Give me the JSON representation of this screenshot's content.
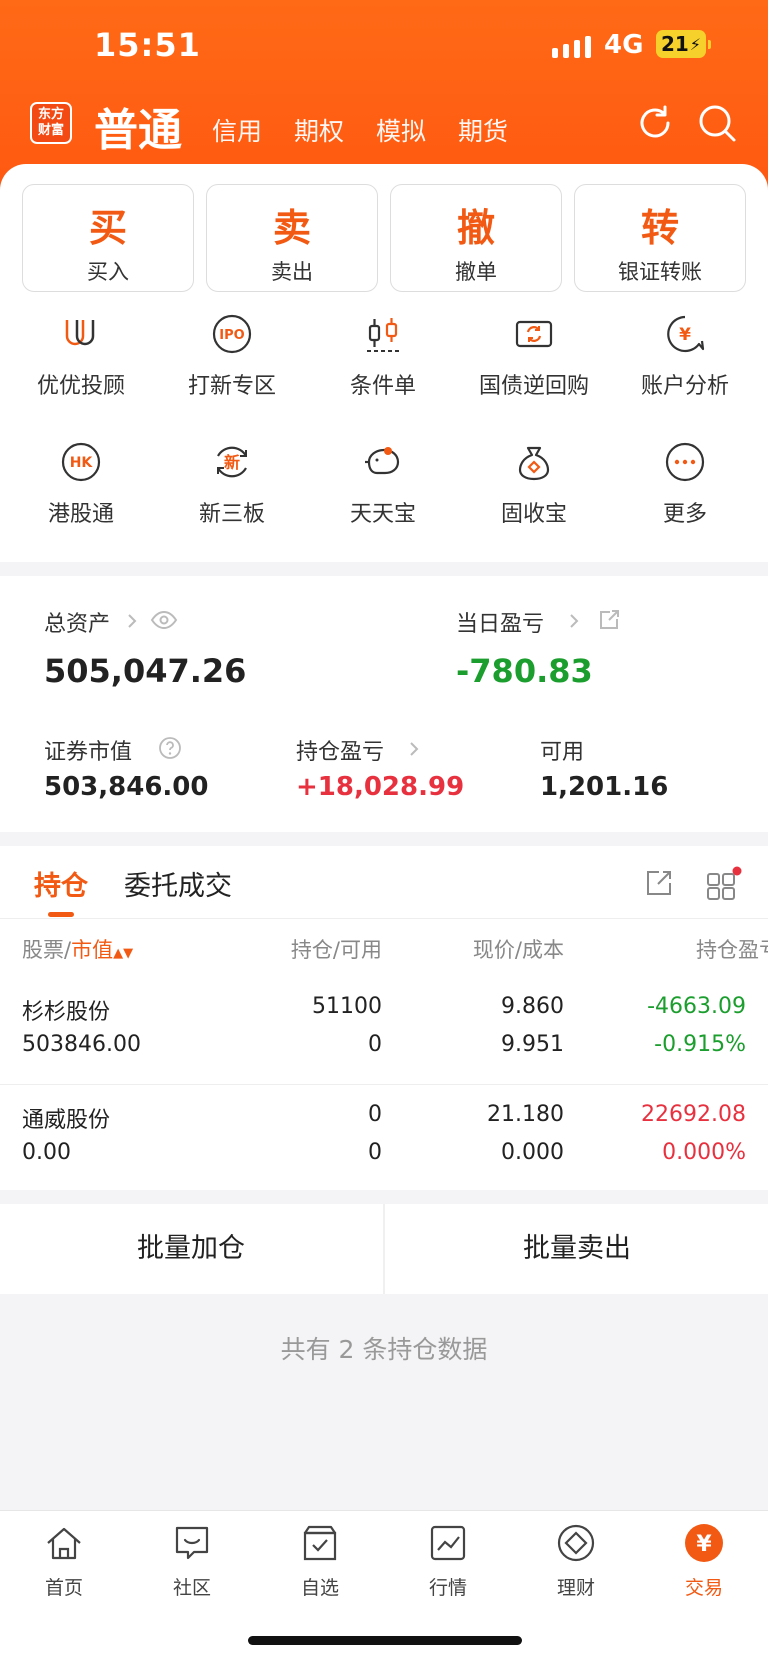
{
  "status": {
    "time": "15:51",
    "network": "4G",
    "battery": "21"
  },
  "header": {
    "logo_text": "东方财富",
    "active_tab": "普通",
    "tabs": [
      "信用",
      "期权",
      "模拟",
      "期货"
    ]
  },
  "actions": [
    {
      "big": "买",
      "label": "买入"
    },
    {
      "big": "卖",
      "label": "卖出"
    },
    {
      "big": "撤",
      "label": "撤单"
    },
    {
      "big": "转",
      "label": "银证转账"
    }
  ],
  "grid": {
    "row1": [
      {
        "label": "优优投顾",
        "icon": "uu-advisor-icon"
      },
      {
        "label": "打新专区",
        "icon": "ipo-icon",
        "icon_text": "IPO"
      },
      {
        "label": "条件单",
        "icon": "candlestick-icon"
      },
      {
        "label": "国债逆回购",
        "icon": "bond-repo-icon"
      },
      {
        "label": "账户分析",
        "icon": "account-analysis-icon",
        "icon_text": "¥"
      }
    ],
    "row2": [
      {
        "label": "港股通",
        "icon": "hk-icon",
        "icon_text": "HK"
      },
      {
        "label": "新三板",
        "icon": "new-board-icon",
        "icon_text": "新"
      },
      {
        "label": "天天宝",
        "icon": "piggy-bank-icon"
      },
      {
        "label": "固收宝",
        "icon": "money-bag-icon"
      },
      {
        "label": "更多",
        "icon": "more-icon"
      }
    ]
  },
  "assets": {
    "total_label": "总资产",
    "total_value": "505,047.26",
    "daily_label": "当日盈亏",
    "daily_value": "-780.83",
    "market_label": "证券市值",
    "market_value": "503,846.00",
    "position_pl_label": "持仓盈亏",
    "position_pl_value": "+18,028.99",
    "available_label": "可用",
    "available_value": "1,201.16"
  },
  "holdings": {
    "tabs": [
      "持仓",
      "委托成交"
    ],
    "headers": {
      "stock": "股票",
      "slash": "/",
      "market": "市值",
      "position": "持仓/可用",
      "price": "现价/成本",
      "pl": "持仓盈亏"
    },
    "rows": [
      {
        "name": "杉杉股份",
        "market_value": "503846.00",
        "position": "51100",
        "available": "0",
        "price": "9.860",
        "cost": "9.951",
        "pl": "-4663.09",
        "pl_pct": "-0.915%"
      },
      {
        "name": "通威股份",
        "market_value": "0.00",
        "position": "0",
        "available": "0",
        "price": "21.180",
        "cost": "0.000",
        "pl": "22692.08",
        "pl_pct": "0.000%"
      }
    ]
  },
  "batch": {
    "add": "批量加仓",
    "sell": "批量卖出"
  },
  "summary": "共有 2 条持仓数据",
  "bottom_nav": [
    {
      "label": "首页",
      "icon": "home-icon"
    },
    {
      "label": "社区",
      "icon": "community-icon"
    },
    {
      "label": "自选",
      "icon": "watchlist-icon"
    },
    {
      "label": "行情",
      "icon": "market-icon"
    },
    {
      "label": "理财",
      "icon": "wealth-icon"
    },
    {
      "label": "交易",
      "icon": "trade-icon",
      "icon_text": "¥",
      "active": true
    }
  ],
  "colors": {
    "brand": "#ff5a14",
    "accent": "#f25a14",
    "red": "#e8313f",
    "green": "#1b9e2e"
  }
}
